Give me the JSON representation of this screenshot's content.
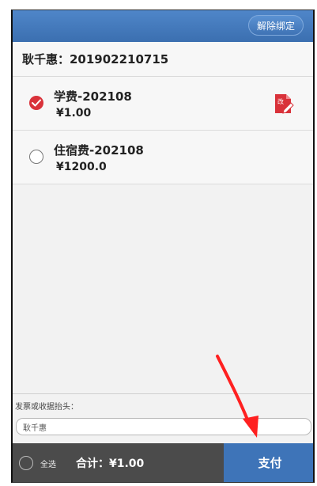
{
  "header": {
    "unbind_label": "解除绑定"
  },
  "student": {
    "line": "耿千惠：201902210715"
  },
  "fees": [
    {
      "title": "学费-202108",
      "amount": "¥1.00",
      "checked": true,
      "edit_icon_text": "改"
    },
    {
      "title": "住宿费-202108",
      "amount": "¥1200.0",
      "checked": false
    }
  ],
  "invoice": {
    "label": "发票或收据抬头：",
    "value": "耿千惠"
  },
  "bottom": {
    "select_all_label": "全选",
    "total_text": "合计：¥1.00",
    "pay_label": "支付"
  },
  "colors": {
    "header_blue": "#3b6fb0",
    "checked_red": "#d9323a",
    "pay_blue": "#3e74b8",
    "bottom_dark": "#4b4b4b",
    "annotation_arrow": "#ff2020"
  },
  "icons": {
    "checkmark": "checkmark-icon",
    "edit": "edit-document-icon",
    "annotation": "red-arrow-icon"
  }
}
